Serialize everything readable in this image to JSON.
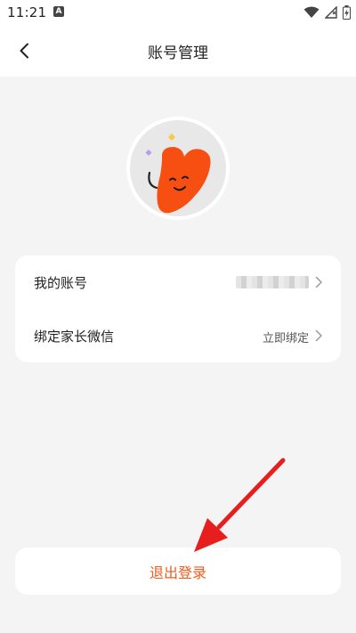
{
  "status_bar": {
    "time": "11:21",
    "notification_icon": "A"
  },
  "header": {
    "title": "账号管理",
    "back_icon": "chevron-left-icon"
  },
  "account_card": {
    "rows": [
      {
        "label": "我的账号",
        "value": ""
      },
      {
        "label": "绑定家长微信",
        "value": "立即绑定"
      }
    ]
  },
  "logout": {
    "label": "退出登录"
  },
  "colors": {
    "accent": "#f25a1c",
    "avatar_heart": "#f74f12",
    "annotation_arrow": "#e61e1e",
    "background": "#f4f4f4"
  }
}
